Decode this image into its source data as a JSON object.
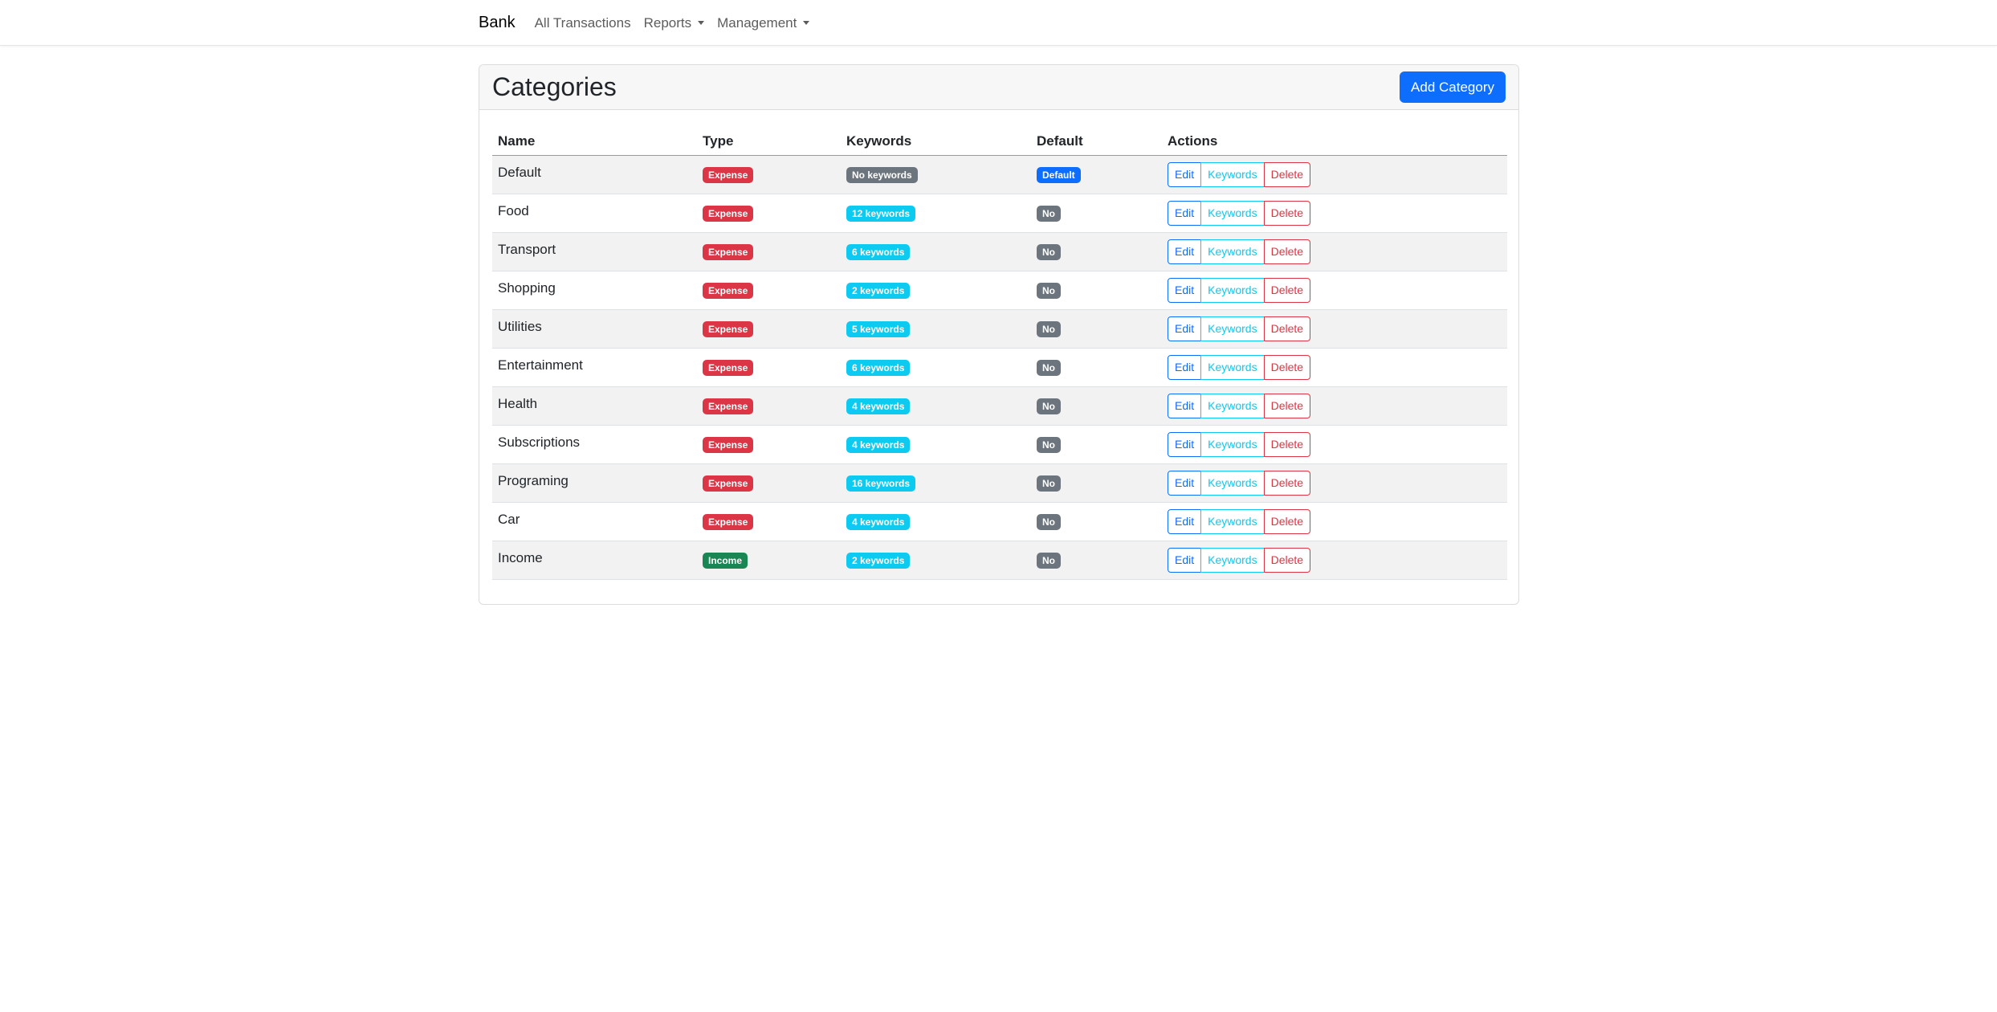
{
  "navbar": {
    "brand": "Bank",
    "links": [
      "All Transactions",
      "Reports",
      "Management"
    ]
  },
  "card": {
    "title": "Categories",
    "add_button": "Add Category"
  },
  "table": {
    "headers": [
      "Name",
      "Type",
      "Keywords",
      "Default",
      "Actions"
    ],
    "actions": [
      "Edit",
      "Keywords",
      "Delete"
    ],
    "rows": [
      {
        "name": "Default",
        "type": "Expense",
        "keywords": "No keywords",
        "default": "Default"
      },
      {
        "name": "Food",
        "type": "Expense",
        "keywords": "12 keywords",
        "default": "No"
      },
      {
        "name": "Transport",
        "type": "Expense",
        "keywords": "6 keywords",
        "default": "No"
      },
      {
        "name": "Shopping",
        "type": "Expense",
        "keywords": "2 keywords",
        "default": "No"
      },
      {
        "name": "Utilities",
        "type": "Expense",
        "keywords": "5 keywords",
        "default": "No"
      },
      {
        "name": "Entertainment",
        "type": "Expense",
        "keywords": "6 keywords",
        "default": "No"
      },
      {
        "name": "Health",
        "type": "Expense",
        "keywords": "4 keywords",
        "default": "No"
      },
      {
        "name": "Subscriptions",
        "type": "Expense",
        "keywords": "4 keywords",
        "default": "No"
      },
      {
        "name": "Programing",
        "type": "Expense",
        "keywords": "16 keywords",
        "default": "No"
      },
      {
        "name": "Car",
        "type": "Expense",
        "keywords": "4 keywords",
        "default": "No"
      },
      {
        "name": "Income",
        "type": "Income",
        "keywords": "2 keywords",
        "default": "No"
      }
    ]
  },
  "colors": {
    "primary": "#0d6efd",
    "danger": "#dc3545",
    "success": "#198754",
    "info": "#0dcaf0",
    "secondary": "#6c757d"
  }
}
